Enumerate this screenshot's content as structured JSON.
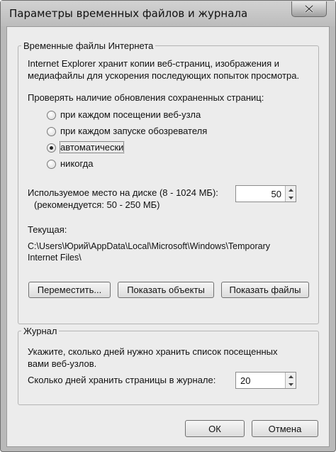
{
  "window": {
    "title": "Параметры временных файлов и журнала"
  },
  "internet_files": {
    "legend": "Временные файлы Интернета",
    "description_line1": "Internet Explorer хранит копии веб-страниц, изображения и",
    "description_line2": "медиафайлы для ускорения последующих попыток просмотра.",
    "check_label": "Проверять наличие обновления сохраненных страниц:",
    "options": [
      {
        "label": "при каждом посещении веб-узла",
        "checked": false
      },
      {
        "label": "при каждом запуске обозревателя",
        "checked": false
      },
      {
        "label": "автоматически",
        "checked": true
      },
      {
        "label": "никогда",
        "checked": false
      }
    ],
    "disk_space_label": "Используемое место на диске (8 - 1024 МБ):",
    "disk_space_hint": "(рекомендуется: 50 - 250 МБ)",
    "disk_space_value": "50",
    "current_label": "Текущая:",
    "current_path_line1": "C:\\Users\\Юрий\\AppData\\Local\\Microsoft\\Windows\\Temporary",
    "current_path_line2": "Internet Files\\",
    "move_button": "Переместить...",
    "show_objects_button": "Показать объекты",
    "show_files_button": "Показать файлы"
  },
  "history": {
    "legend": "Журнал",
    "description_line1": "Укажите, сколько дней нужно хранить список посещенных",
    "description_line2": "вами веб-узлов.",
    "days_label": "Сколько дней хранить страницы в журнале:",
    "days_value": "20"
  },
  "footer": {
    "ok_button": "ОК",
    "cancel_button": "Отмена"
  }
}
